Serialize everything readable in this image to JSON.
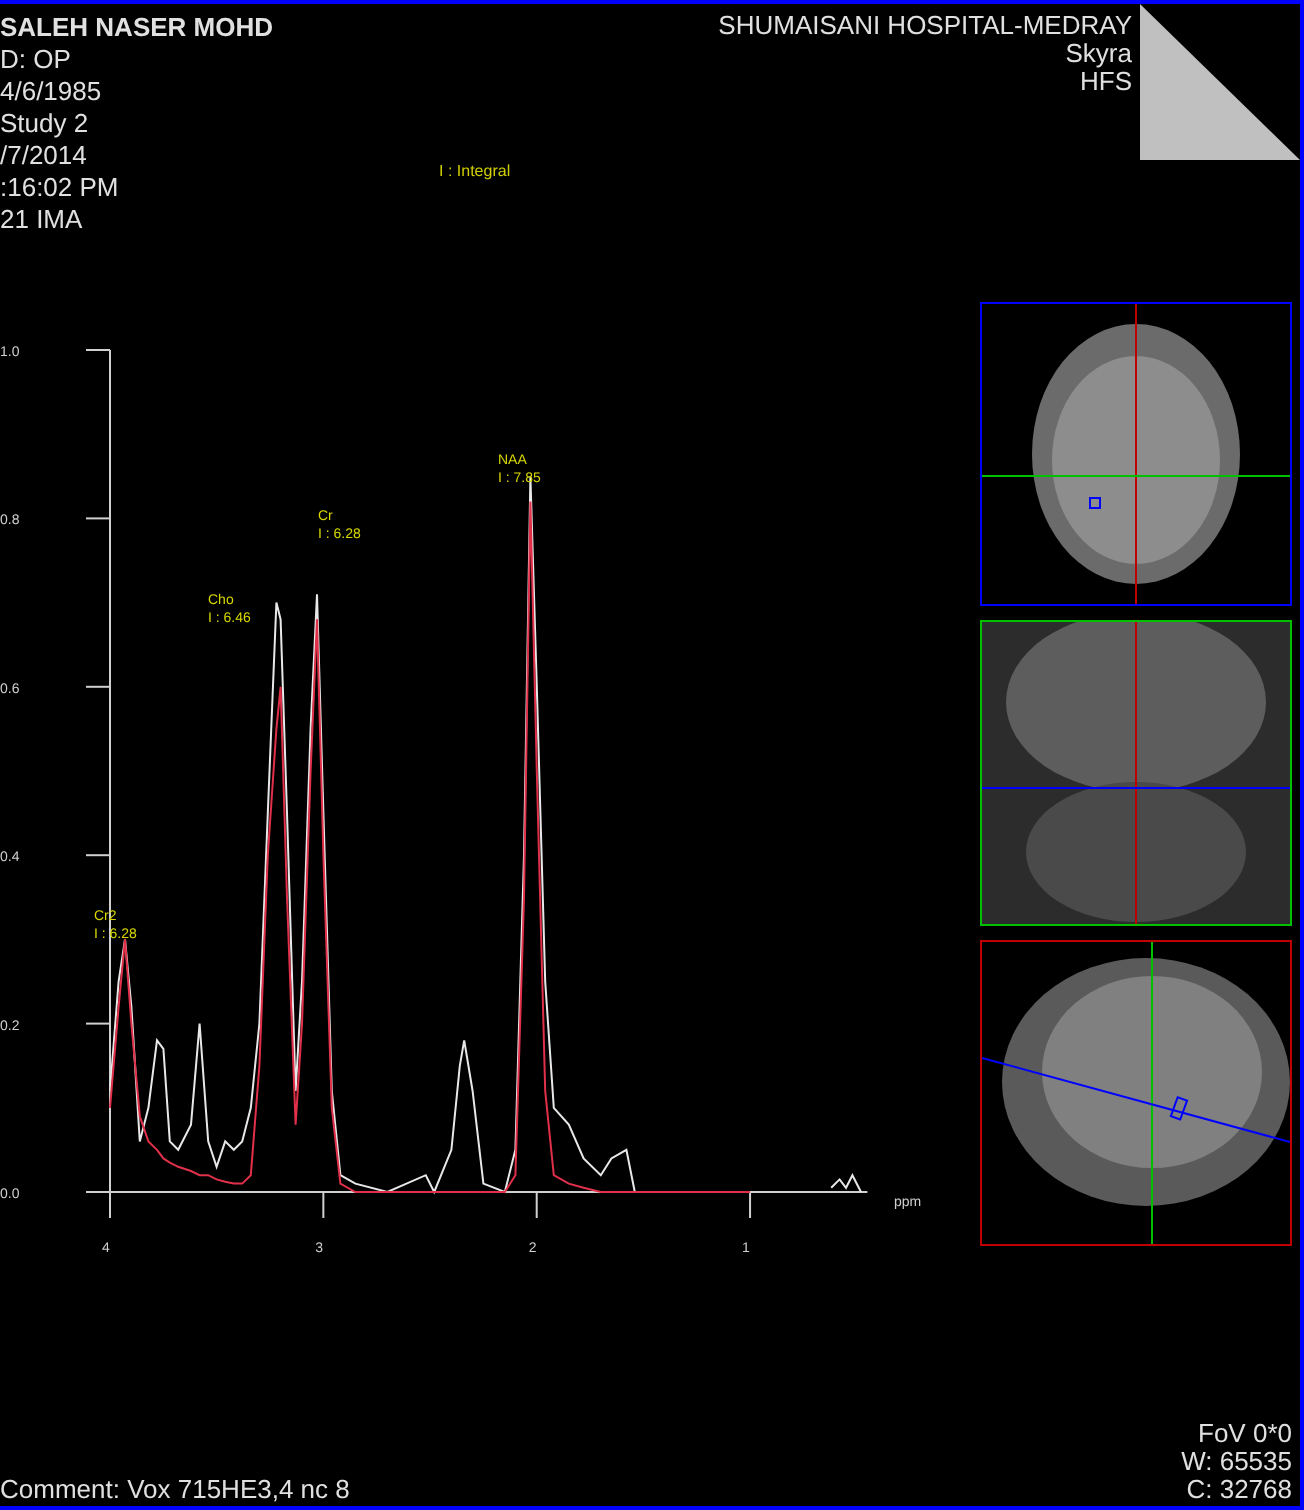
{
  "patient_info": [
    "SALEH NASER MOHD",
    "D: OP",
    "4/6/1985",
    "Study 2",
    "/7/2014",
    ":16:02 PM",
    "21 IMA"
  ],
  "legend": "I : Integral",
  "site_info": [
    "SHUMAISANI HOSPITAL-MEDRAY",
    "Skyra",
    "HFS"
  ],
  "spectrum": {
    "chart_data": {
      "type": "line",
      "xlabel": "ppm",
      "x": [
        4.0,
        3.96,
        3.93,
        3.9,
        3.86,
        3.82,
        3.78,
        3.75,
        3.72,
        3.68,
        3.62,
        3.58,
        3.54,
        3.5,
        3.46,
        3.42,
        3.38,
        3.34,
        3.3,
        3.26,
        3.22,
        3.2,
        3.17,
        3.13,
        3.1,
        3.06,
        3.03,
        3.0,
        2.96,
        2.92,
        2.85,
        2.7,
        2.52,
        2.48,
        2.4,
        2.36,
        2.34,
        2.3,
        2.25,
        2.15,
        2.1,
        2.06,
        2.03,
        2.0,
        1.96,
        1.92,
        1.85,
        1.78,
        1.7,
        1.65,
        1.58,
        1.54,
        1.0,
        0.62,
        0.58,
        0.55,
        0.52,
        0.48
      ],
      "series": [
        {
          "color": "#e8e8e8",
          "values": [
            0.12,
            0.25,
            0.3,
            0.22,
            0.06,
            0.1,
            0.18,
            0.17,
            0.06,
            0.05,
            0.08,
            0.2,
            0.06,
            0.03,
            0.06,
            0.05,
            0.06,
            0.1,
            0.2,
            0.45,
            0.7,
            0.68,
            0.45,
            0.12,
            0.25,
            0.55,
            0.71,
            0.45,
            0.12,
            0.02,
            0.01,
            0,
            0.02,
            0,
            0.05,
            0.15,
            0.18,
            0.12,
            0.01,
            0,
            0.05,
            0.4,
            0.85,
            0.6,
            0.25,
            0.1,
            0.08,
            0.04,
            0.02,
            0.04,
            0.05,
            0,
            null,
            0.005,
            0.015,
            0.005,
            0.02,
            0
          ]
        },
        {
          "color": "#e0304a",
          "values": [
            0.1,
            0.22,
            0.3,
            0.2,
            0.09,
            0.06,
            0.05,
            0.04,
            0.035,
            0.03,
            0.025,
            0.02,
            0.02,
            0.015,
            0.012,
            0.01,
            0.01,
            0.02,
            0.15,
            0.4,
            0.55,
            0.6,
            0.35,
            0.08,
            0.2,
            0.5,
            0.68,
            0.4,
            0.1,
            0.01,
            0,
            0,
            0,
            0,
            0,
            0,
            0,
            0,
            0,
            0,
            0.02,
            0.35,
            0.82,
            0.5,
            0.12,
            0.02,
            0.01,
            0.005,
            0,
            0,
            0,
            0,
            0,
            null,
            null,
            null,
            null,
            null
          ]
        }
      ],
      "xlim": [
        4.0,
        0.45
      ],
      "ylim": [
        0,
        1
      ],
      "xticks": [
        {
          "value": 4,
          "label": "4"
        },
        {
          "value": 3,
          "label": "3"
        },
        {
          "value": 2,
          "label": "2"
        },
        {
          "value": 1,
          "label": "1"
        }
      ],
      "yticks": [
        {
          "value": 1,
          "label": "1.0"
        },
        {
          "value": 0.8,
          "label": "0.8"
        },
        {
          "value": 0.6,
          "label": "0.6"
        },
        {
          "value": 0.4,
          "label": "0.4"
        },
        {
          "value": 0.2,
          "label": "0.2"
        },
        {
          "value": 0,
          "label": "0.0"
        }
      ]
    },
    "peaks": [
      {
        "name": "Cr2",
        "integral": "I : 6.28"
      },
      {
        "name": "Cho",
        "integral": "I : 6.46"
      },
      {
        "name": "Cr",
        "integral": "I : 6.28"
      },
      {
        "name": "NAA",
        "integral": "I : 7.85"
      }
    ]
  },
  "views": [
    {
      "kind": "axial",
      "color": "#0000ff"
    },
    {
      "kind": "coronal",
      "color": "#00c000"
    },
    {
      "kind": "sagittal",
      "color": "#c00000"
    }
  ],
  "comment": "Comment: Vox 715HE3,4 nc 8",
  "image_info": [
    "FoV 0*0",
    "W: 65535",
    "C: 32768"
  ]
}
